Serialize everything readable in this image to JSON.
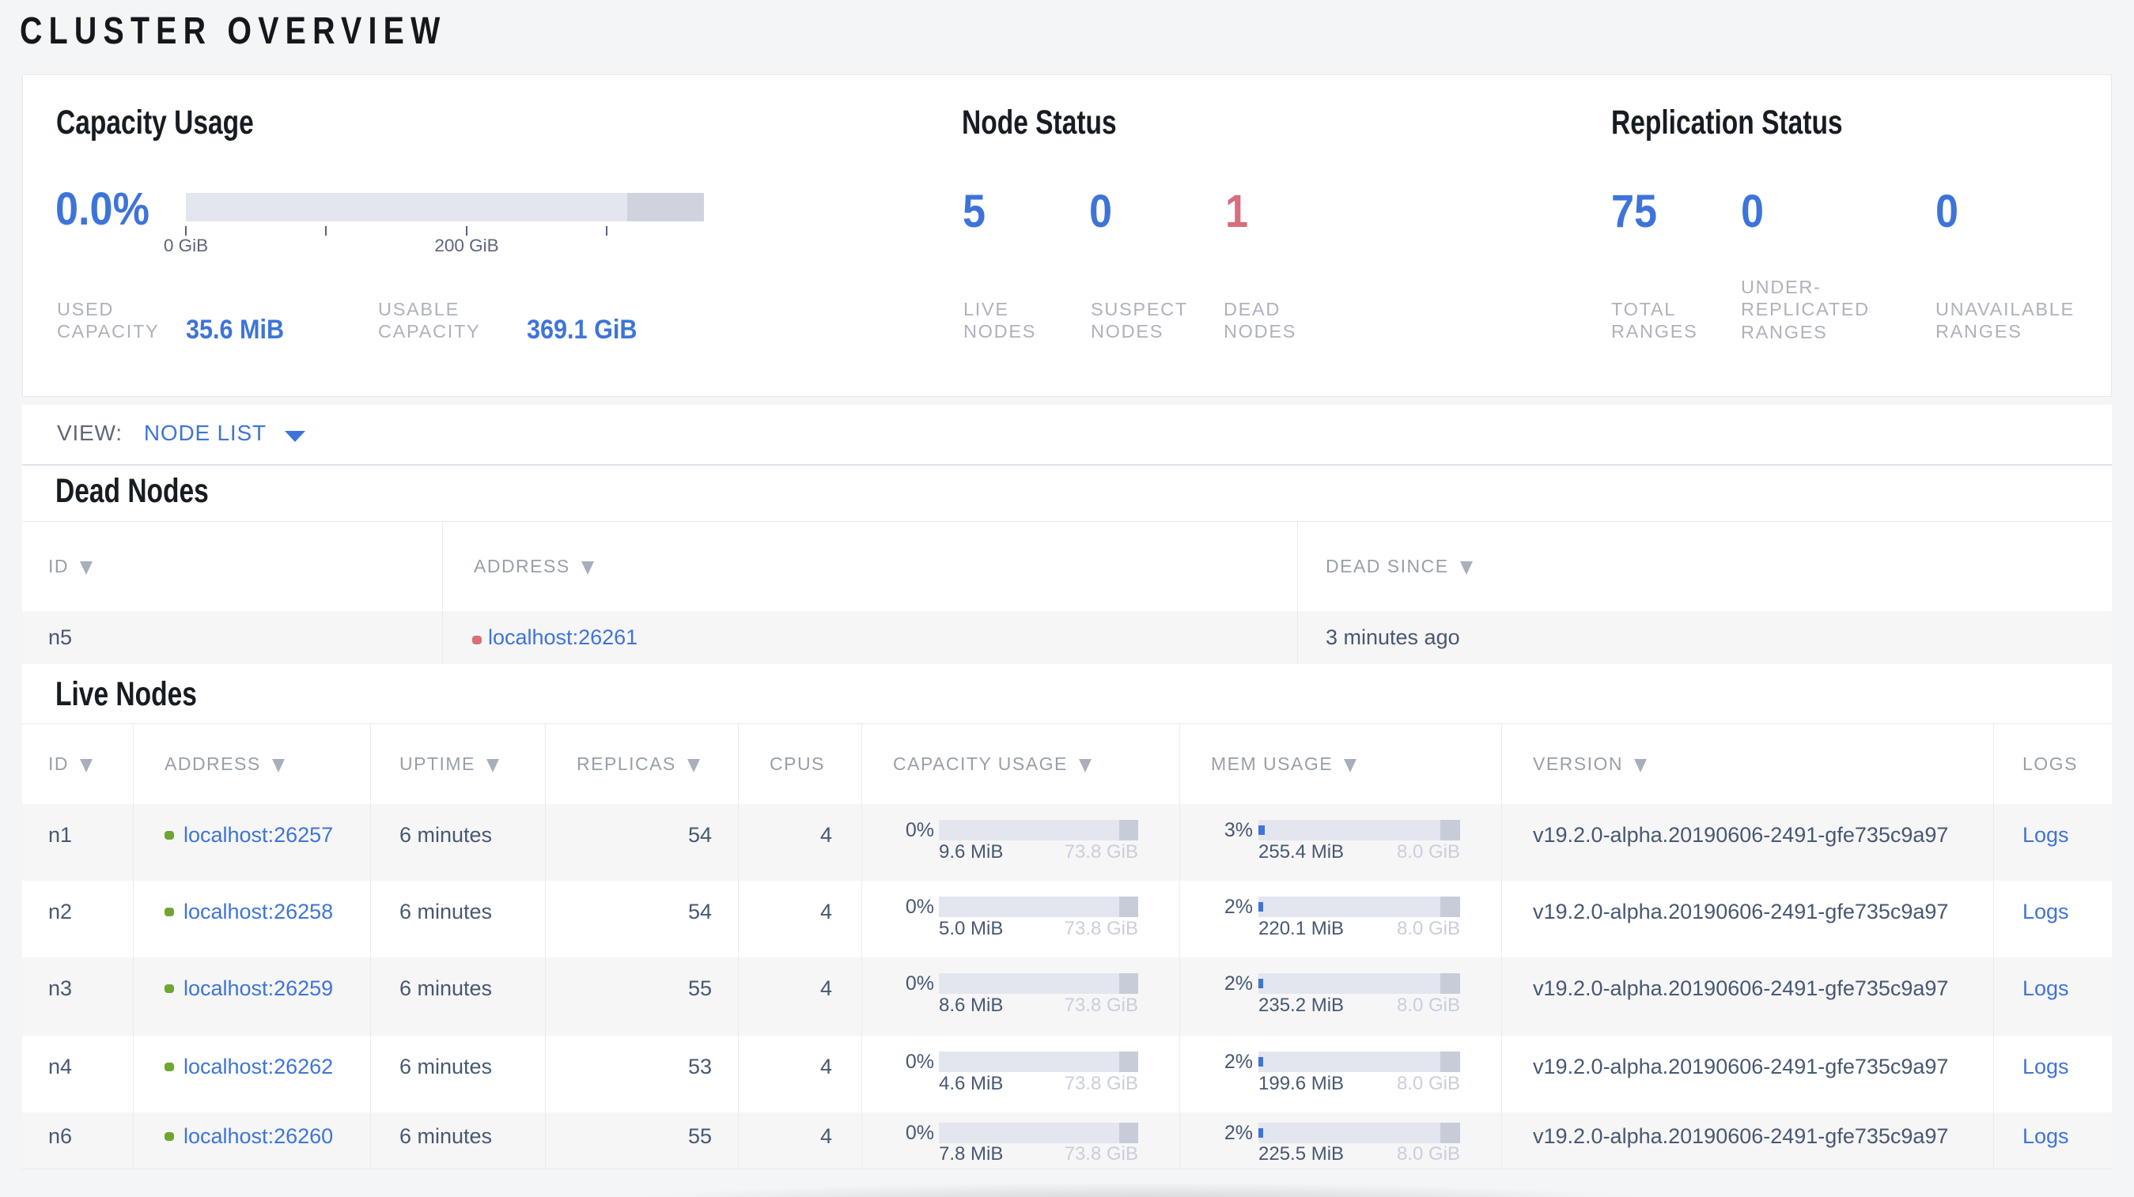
{
  "title": "CLUSTER OVERVIEW",
  "overview": {
    "capacity": {
      "heading": "Capacity Usage",
      "percent": "0.0%",
      "axis_ticks": [
        "0 GiB",
        "200 GiB"
      ],
      "used_label_line1": "USED",
      "used_label_line2": "CAPACITY",
      "used_value": "35.6 MiB",
      "usable_label_line1": "USABLE",
      "usable_label_line2": "CAPACITY",
      "usable_value": "369.1 GiB"
    },
    "node_status": {
      "heading": "Node Status",
      "live_count": "5",
      "suspect_count": "0",
      "dead_count": "1",
      "live_label_line1": "LIVE",
      "live_label_line2": "NODES",
      "suspect_label_line1": "SUSPECT",
      "suspect_label_line2": "NODES",
      "dead_label_line1": "DEAD",
      "dead_label_line2": "NODES"
    },
    "replication": {
      "heading": "Replication Status",
      "total_ranges": "75",
      "under_replicated": "0",
      "unavailable": "0",
      "total_label_line1": "TOTAL",
      "total_label_line2": "RANGES",
      "under_label_line1": "UNDER-",
      "under_label_line2": "REPLICATED",
      "under_label_line3": "RANGES",
      "unavailable_label_line1": "UNAVAILABLE",
      "unavailable_label_line2": "RANGES"
    }
  },
  "view_bar": {
    "label": "VIEW:",
    "value": "NODE LIST"
  },
  "dead_nodes": {
    "heading": "Dead Nodes",
    "columns": [
      {
        "label": "ID"
      },
      {
        "label": "ADDRESS"
      },
      {
        "label": "DEAD SINCE"
      }
    ],
    "row": {
      "id": "n5",
      "address": "localhost:26261",
      "dead_since": "3 minutes ago"
    }
  },
  "live_nodes": {
    "heading": "Live Nodes",
    "columns": [
      {
        "label": "ID"
      },
      {
        "label": "ADDRESS"
      },
      {
        "label": "UPTIME"
      },
      {
        "label": "REPLICAS"
      },
      {
        "label": "CPUS"
      },
      {
        "label": "CAPACITY USAGE"
      },
      {
        "label": "MEM USAGE"
      },
      {
        "label": "VERSION"
      },
      {
        "label": "LOGS"
      }
    ],
    "rows": [
      {
        "id": "n1",
        "address": "localhost:26257",
        "uptime": "6 minutes",
        "replicas": "54",
        "cpus": "4",
        "cap_pct": "0%",
        "cap_used": "9.6 MiB",
        "cap_total": "73.8 GiB",
        "mem_pct": "3%",
        "mem_used": "255.4 MiB",
        "mem_total": "8.0 GiB",
        "version": "v19.2.0-alpha.20190606-2491-gfe735c9a97",
        "logs": "Logs"
      },
      {
        "id": "n2",
        "address": "localhost:26258",
        "uptime": "6 minutes",
        "replicas": "54",
        "cpus": "4",
        "cap_pct": "0%",
        "cap_used": "5.0 MiB",
        "cap_total": "73.8 GiB",
        "mem_pct": "2%",
        "mem_used": "220.1 MiB",
        "mem_total": "8.0 GiB",
        "version": "v19.2.0-alpha.20190606-2491-gfe735c9a97",
        "logs": "Logs"
      },
      {
        "id": "n3",
        "address": "localhost:26259",
        "uptime": "6 minutes",
        "replicas": "55",
        "cpus": "4",
        "cap_pct": "0%",
        "cap_used": "8.6 MiB",
        "cap_total": "73.8 GiB",
        "mem_pct": "2%",
        "mem_used": "235.2 MiB",
        "mem_total": "8.0 GiB",
        "version": "v19.2.0-alpha.20190606-2491-gfe735c9a97",
        "logs": "Logs"
      },
      {
        "id": "n4",
        "address": "localhost:26262",
        "uptime": "6 minutes",
        "replicas": "53",
        "cpus": "4",
        "cap_pct": "0%",
        "cap_used": "4.6 MiB",
        "cap_total": "73.8 GiB",
        "mem_pct": "2%",
        "mem_used": "199.6 MiB",
        "mem_total": "8.0 GiB",
        "version": "v19.2.0-alpha.20190606-2491-gfe735c9a97",
        "logs": "Logs"
      },
      {
        "id": "n6",
        "address": "localhost:26260",
        "uptime": "6 minutes",
        "replicas": "55",
        "cpus": "4",
        "cap_pct": "0%",
        "cap_used": "7.8 MiB",
        "cap_total": "73.8 GiB",
        "mem_pct": "2%",
        "mem_used": "225.5 MiB",
        "mem_total": "8.0 GiB",
        "version": "v19.2.0-alpha.20190606-2491-gfe735c9a97",
        "logs": "Logs"
      }
    ]
  }
}
